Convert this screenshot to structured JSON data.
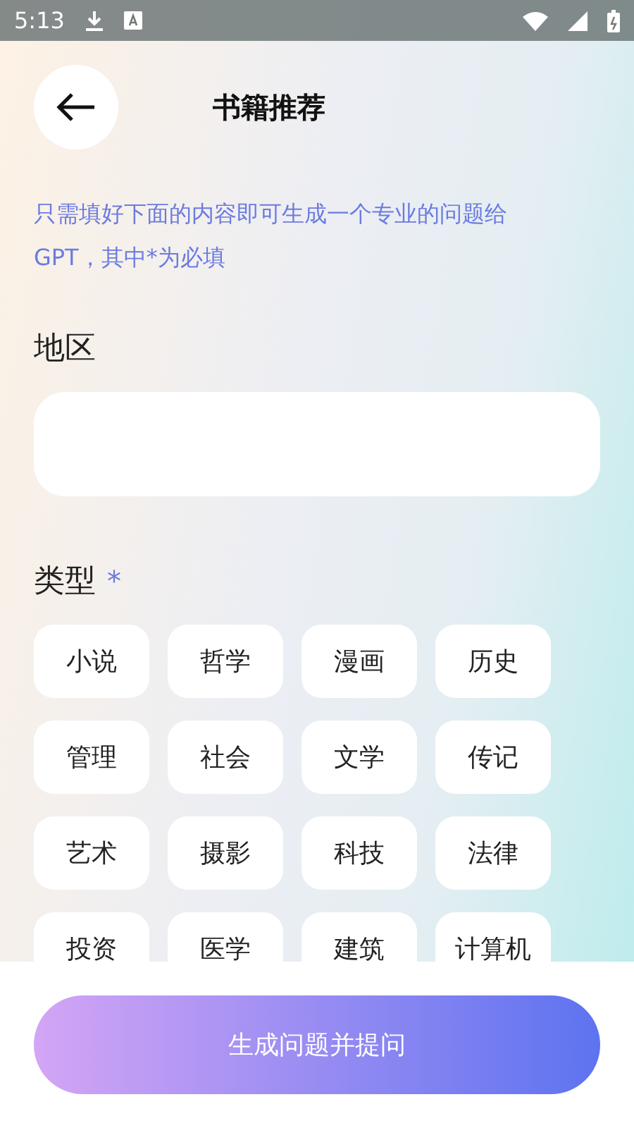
{
  "status_bar": {
    "time": "5:13"
  },
  "header": {
    "title": "书籍推荐"
  },
  "intro": "只需填好下面的内容即可生成一个专业的问题给GPT，其中*为必填",
  "region": {
    "label": "地区"
  },
  "type": {
    "label": "类型",
    "required": true,
    "required_mark": "*",
    "options": [
      {
        "label": "小说",
        "selected": false
      },
      {
        "label": "哲学",
        "selected": false
      },
      {
        "label": "漫画",
        "selected": false
      },
      {
        "label": "历史",
        "selected": false
      },
      {
        "label": "管理",
        "selected": false
      },
      {
        "label": "社会",
        "selected": false
      },
      {
        "label": "文学",
        "selected": false
      },
      {
        "label": "传记",
        "selected": false
      },
      {
        "label": "艺术",
        "selected": false
      },
      {
        "label": "摄影",
        "selected": false
      },
      {
        "label": "科技",
        "selected": false
      },
      {
        "label": "法律",
        "selected": false
      },
      {
        "label": "投资",
        "selected": false
      },
      {
        "label": "医学",
        "selected": false
      },
      {
        "label": "建筑",
        "selected": false
      },
      {
        "label": "计算机",
        "selected": false
      }
    ]
  },
  "submit_button": "生成问题并提问"
}
